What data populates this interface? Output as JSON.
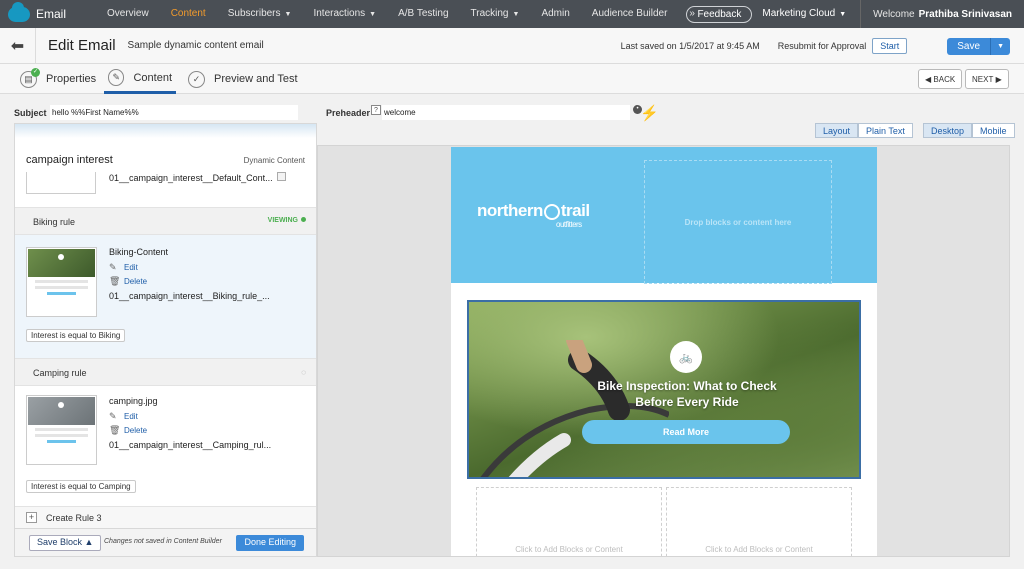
{
  "app": {
    "name": "Email"
  },
  "nav": {
    "items": [
      {
        "label": "Overview",
        "active": false,
        "dropdown": false
      },
      {
        "label": "Content",
        "active": true,
        "dropdown": false
      },
      {
        "label": "Subscribers",
        "active": false,
        "dropdown": true
      },
      {
        "label": "Interactions",
        "active": false,
        "dropdown": true
      },
      {
        "label": "A/B Testing",
        "active": false,
        "dropdown": false
      },
      {
        "label": "Tracking",
        "active": false,
        "dropdown": true
      },
      {
        "label": "Admin",
        "active": false,
        "dropdown": false
      },
      {
        "label": "Audience Builder",
        "active": false,
        "dropdown": false
      }
    ],
    "more": "»",
    "feedback": "Feedback",
    "marketing_cloud": "Marketing Cloud",
    "welcome": "Welcome",
    "user": "Prathiba Srinivasan"
  },
  "titlebar": {
    "title": "Edit Email",
    "email_name": "Sample dynamic content email",
    "last_saved": "Last saved on 1/5/2017 at 9:45 AM",
    "resubmit": "Resubmit for Approval",
    "start": "Start",
    "save": "Save"
  },
  "steps": {
    "properties": "Properties",
    "content": "Content",
    "preview": "Preview and Test",
    "back": "BACK",
    "next": "NEXT"
  },
  "fields": {
    "subject_label": "Subject",
    "subject_value": "hello %%First Name%%",
    "preheader_label": "Preheader",
    "preheader_value": "welcome",
    "help": "?"
  },
  "left_panel": {
    "title": "campaign interest",
    "type": "Dynamic Content",
    "default_file": "01__campaign_interest__Default_Cont...",
    "rules": [
      {
        "name": "Biking rule",
        "status": "VIEWING",
        "content_name": "Biking-Content",
        "edit": "Edit",
        "delete": "Delete",
        "file": "01__campaign_interest__Biking_rule_...",
        "condition": "Interest is equal to Biking"
      },
      {
        "name": "Camping rule",
        "content_name": "camping.jpg",
        "edit": "Edit",
        "delete": "Delete",
        "file": "01__campaign_interest__Camping_rul...",
        "condition": "Interest is equal to Camping"
      }
    ],
    "create_rule": "Create Rule 3",
    "save_block": "Save Block",
    "unsaved": "Changes not saved in Content Builder",
    "done": "Done Editing"
  },
  "view_toggles": {
    "layout": "Layout",
    "plain_text": "Plain Text",
    "desktop": "Desktop",
    "mobile": "Mobile"
  },
  "canvas": {
    "logo_main": "northern",
    "logo_end": "trail",
    "logo_sub": "outfitters",
    "drop_blocks": "Drop blocks or content here",
    "hero_title": "Bike Inspection: What to Check Before Every Ride",
    "read_more": "Read More",
    "add_blocks": "Click to Add Blocks or Content"
  },
  "colors": {
    "nav_bg": "#4a4f55",
    "accent": "#f29b2c",
    "primary": "#3c8ad9",
    "brand_sky": "#6ac4ec"
  }
}
